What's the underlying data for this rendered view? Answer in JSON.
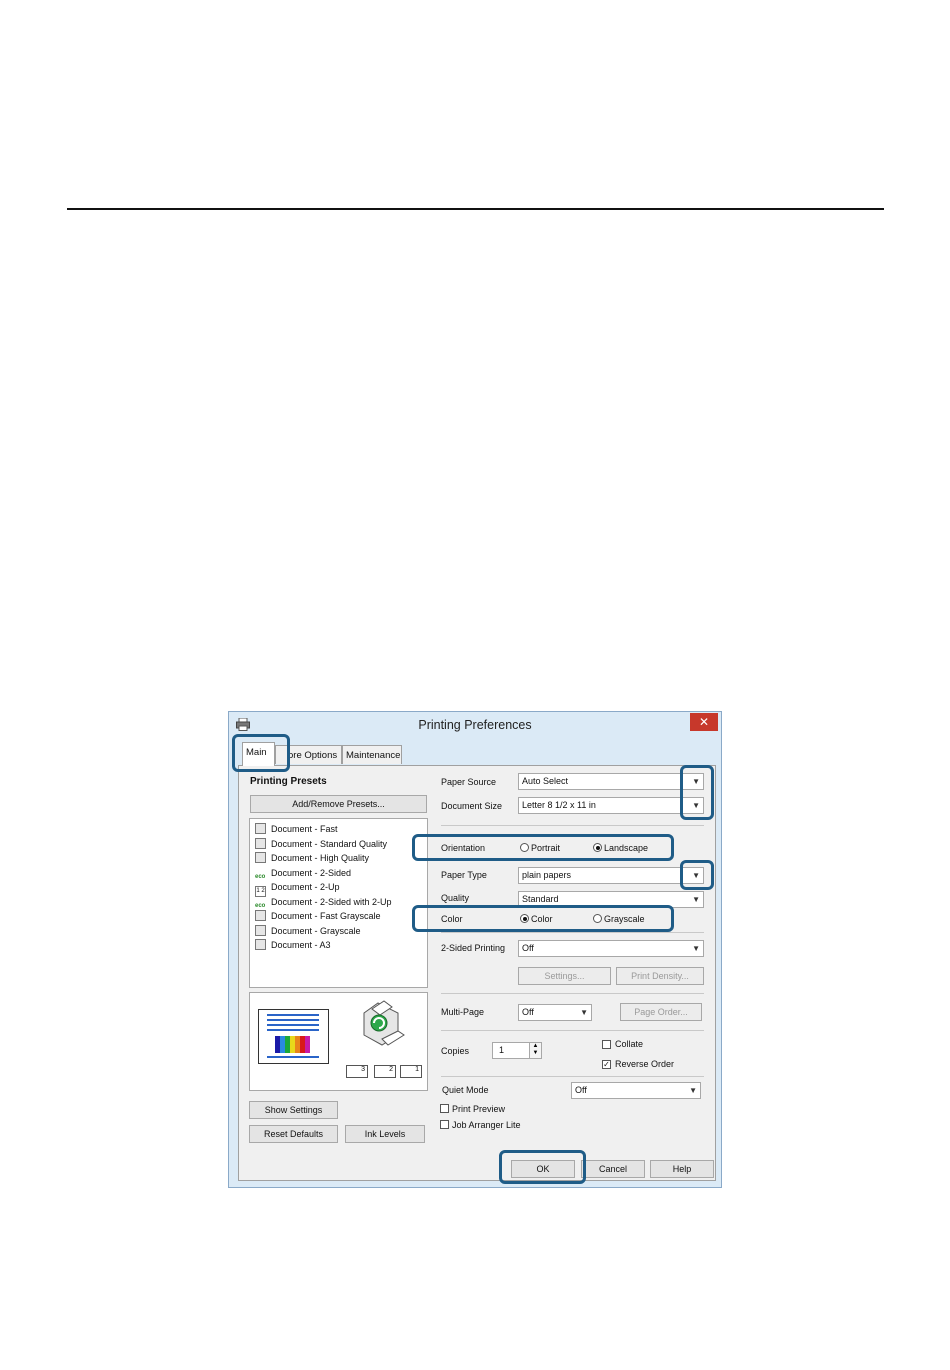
{
  "dialog": {
    "title": "Printing Preferences",
    "close_label": "✕",
    "tabs": [
      {
        "label": "Main"
      },
      {
        "label": "ore Options"
      },
      {
        "label": "Maintenance"
      }
    ]
  },
  "left": {
    "presets_header": "Printing Presets",
    "add_remove_label": "Add/Remove Presets...",
    "presets": [
      {
        "label": "Document - Fast",
        "icon": "doc"
      },
      {
        "label": "Document - Standard Quality",
        "icon": "doc"
      },
      {
        "label": "Document - High Quality",
        "icon": "doc"
      },
      {
        "label": "Document - 2-Sided",
        "icon": "eco"
      },
      {
        "label": "Document - 2-Up",
        "icon": "up",
        "icon_text": "1 2"
      },
      {
        "label": "Document - 2-Sided with 2-Up",
        "icon": "eco"
      },
      {
        "label": "Document - Fast Grayscale",
        "icon": "doc"
      },
      {
        "label": "Document - Grayscale",
        "icon": "doc"
      },
      {
        "label": "Document - A3",
        "icon": "doc"
      }
    ],
    "eco_text": "eco",
    "tray_labels": [
      "3",
      "2",
      "1"
    ],
    "show_settings_label": "Show Settings",
    "reset_defaults_label": "Reset Defaults",
    "ink_levels_label": "Ink Levels"
  },
  "right": {
    "paper_source_label": "Paper Source",
    "paper_source_value": "Auto Select",
    "document_size_label": "Document Size",
    "document_size_value": "Letter 8 1/2 x 11 in",
    "orientation_label": "Orientation",
    "portrait_label": "Portrait",
    "landscape_label": "Landscape",
    "paper_type_label": "Paper Type",
    "paper_type_value": "plain papers",
    "quality_label": "Quality",
    "quality_value": "Standard",
    "color_label": "Color",
    "color_option_label": "Color",
    "grayscale_label": "Grayscale",
    "two_sided_label": "2-Sided Printing",
    "two_sided_value": "Off",
    "settings_label": "Settings...",
    "print_density_label": "Print Density...",
    "multi_page_label": "Multi-Page",
    "multi_page_value": "Off",
    "page_order_label": "Page Order...",
    "copies_label": "Copies",
    "copies_value": "1",
    "collate_label": "Collate",
    "reverse_order_label": "Reverse Order",
    "quiet_mode_label": "Quiet Mode",
    "quiet_mode_value": "Off",
    "print_preview_label": "Print Preview",
    "job_arranger_label": "Job Arranger Lite"
  },
  "footer": {
    "ok_label": "OK",
    "cancel_label": "Cancel",
    "help_label": "Help"
  },
  "colors": {
    "highlight": "#1f5c87",
    "dialog_frame": "#dbeaf6",
    "close": "#c7382b"
  }
}
